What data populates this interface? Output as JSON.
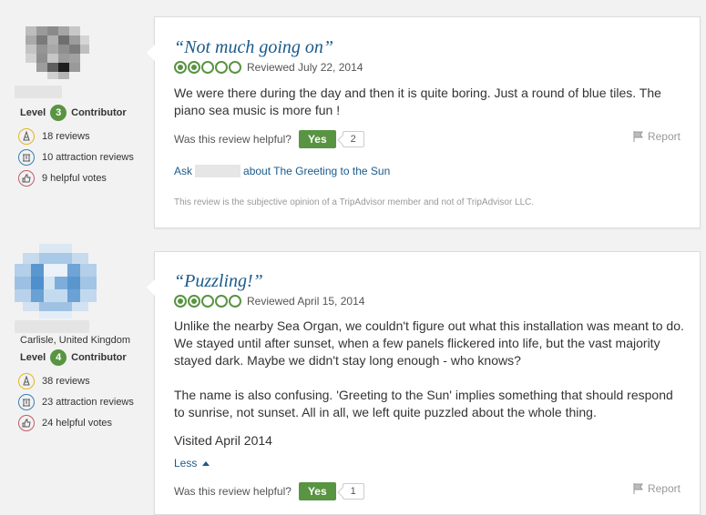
{
  "reviews": [
    {
      "reviewer": {
        "level_label": "Level",
        "level": "3",
        "role": "Contributor",
        "stats": [
          {
            "icon": "pen-icon",
            "text": "18 reviews"
          },
          {
            "icon": "attraction-icon",
            "text": "10 attraction reviews"
          },
          {
            "icon": "thumbs-up-icon",
            "text": "9 helpful votes"
          }
        ]
      },
      "title": "“Not much going on”",
      "rating": 2,
      "reviewed_date": "Reviewed July 22, 2014",
      "paragraphs": [
        "We were there during the day and then it is quite boring. Just a round of blue tiles. The piano sea music is more fun !"
      ],
      "helpful_prompt": "Was this review helpful?",
      "yes_label": "Yes",
      "helpful_count": "2",
      "report_label": "Report",
      "ask_prefix": "Ask",
      "ask_suffix": "about The Greeting to the Sun",
      "disclaimer": "This review is the subjective opinion of a TripAdvisor member and not of TripAdvisor LLC."
    },
    {
      "reviewer": {
        "location": "Carlisle, United Kingdom",
        "level_label": "Level",
        "level": "4",
        "role": "Contributor",
        "stats": [
          {
            "icon": "pen-icon",
            "text": "38 reviews"
          },
          {
            "icon": "attraction-icon",
            "text": "23 attraction reviews"
          },
          {
            "icon": "thumbs-up-icon",
            "text": "24 helpful votes"
          }
        ]
      },
      "title": "“Puzzling!”",
      "rating": 2,
      "reviewed_date": "Reviewed April 15, 2014",
      "paragraphs": [
        "Unlike the nearby Sea Organ, we couldn't figure out what this installation was meant to do. We stayed until after sunset, when a few panels flickered into life, but the vast majority stayed dark. Maybe we didn't stay long enough - who knows?",
        "The name is also confusing. 'Greeting to the Sun' implies something that should respond to sunrise, not sunset. All in all, we left quite puzzled about the whole thing."
      ],
      "visited": "Visited April 2014",
      "less_label": "Less",
      "helpful_prompt": "Was this review helpful?",
      "yes_label": "Yes",
      "helpful_count": "1",
      "report_label": "Report"
    }
  ],
  "colors": {
    "accent_green": "#589442",
    "link_blue": "#1a5a8a"
  }
}
